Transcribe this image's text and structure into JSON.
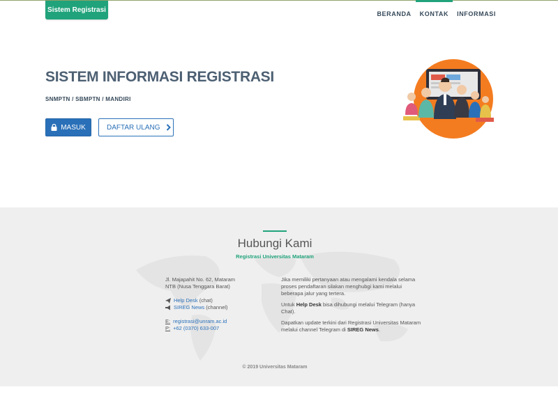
{
  "header": {
    "brand": "Sistem Registrasi",
    "nav": [
      {
        "label": "BERANDA",
        "active": false
      },
      {
        "label": "KONTAK",
        "active": true
      },
      {
        "label": "INFORMASI",
        "active": false
      }
    ]
  },
  "hero": {
    "title": "SISTEM INFORMASI REGISTRASI",
    "subtitle": "SNMPTN / SBMPTN / MANDIRI",
    "btn_login": "MASUK",
    "btn_reregister": "DAFTAR ULANG",
    "icons": {
      "login": "lock-icon",
      "reregister": "chevron-right-icon",
      "illustration": "people-group-illustration"
    }
  },
  "footer": {
    "title": "Hubungi Kami",
    "subtitle": "Registrasi Universitas Mataram",
    "address_line1": "Jl. Majapahit No. 62, Mataram",
    "address_line2": "NTB (Nusa Tenggara Barat)",
    "helpdesk_link": "Help Desk",
    "helpdesk_suffix": "(chat)",
    "news_link": "SIREG News",
    "news_suffix": "(channel)",
    "email_label": "E:",
    "email": "registrasi@unram.ac.id",
    "phone_label": "P:",
    "phone": "+62 (0370) 633-007",
    "info_p1": "Jika memiliki pertanyaan atau mengalami kendala selama proses pendaftaran silakan menghubgi kami melalui beberapa jalur yang tertera.",
    "info_p2_a": "Untuk ",
    "info_p2_b": "Help Desk",
    "info_p2_c": " bisa dihubungi melalui Telegram (hanya Chat).",
    "info_p3_a": "Dapatkan update terkini dari Registrasi Universitas Mataram melalui channel Telegram di ",
    "info_p3_b": "SIREG News",
    "info_p3_c": ".",
    "copyright": "© 2019 Universitas Mataram"
  },
  "colors": {
    "accent": "#20a37b",
    "primary": "#2a70b8",
    "illustration_bg": "#f47c20"
  }
}
